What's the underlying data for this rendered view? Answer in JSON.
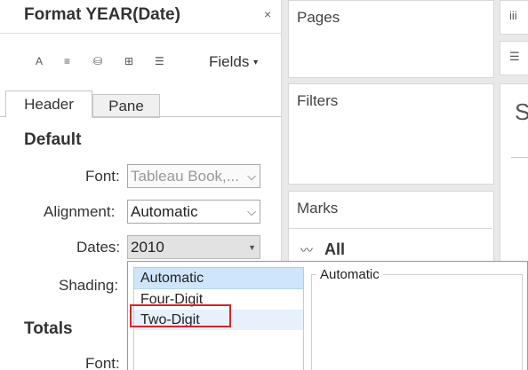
{
  "panel": {
    "title": "Format YEAR(Date)",
    "close_icon": "×",
    "fields_label": "Fields",
    "fields_caret": "▾",
    "tools": [
      {
        "name": "font-icon",
        "glyph": "A"
      },
      {
        "name": "alignment-icon",
        "glyph": "≡"
      },
      {
        "name": "shading-icon",
        "glyph": "⛁"
      },
      {
        "name": "borders-icon",
        "glyph": "⊞"
      },
      {
        "name": "lines-icon",
        "glyph": "☰"
      }
    ],
    "tabs": {
      "header": "Header",
      "pane": "Pane"
    },
    "default_section": "Default",
    "totals_section": "Totals",
    "rows": {
      "font_label": "Font:",
      "font_value": "Tableau Book,...",
      "alignment_label": "Alignment:",
      "alignment_value": "Automatic",
      "dates_label": "Dates:",
      "dates_value": "2010",
      "shading_label": "Shading:",
      "totals_font_label": "Font:"
    }
  },
  "shelves": {
    "pages": "Pages",
    "filters": "Filters",
    "marks": "Marks",
    "all": "All",
    "all_icon": "〰"
  },
  "right": {
    "top_icon": "iii",
    "list_icon": "☰",
    "s_glyph": "S"
  },
  "dropdown": {
    "options": [
      "Automatic",
      "Four-Digit",
      "Two-Digit"
    ],
    "selected": "Automatic",
    "hovered": "Two-Digit",
    "preview_label": "Automatic",
    "highlight_color": "#d4232e"
  }
}
